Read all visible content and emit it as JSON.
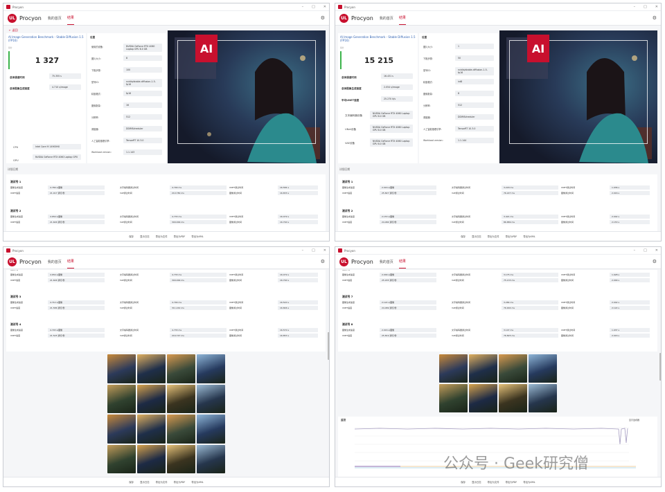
{
  "window_title": "Procyon",
  "brand": "Procyon",
  "tabs": [
    "我的首页",
    "结果"
  ],
  "back_label": "← 返回",
  "footer_buttons": [
    "保存",
    "显示日志",
    "导出为文件",
    "导出为PDF",
    "导出为XML"
  ],
  "w1": {
    "bench_title": "AI Image Generation Benchmark - Stable Diffusion 1.5 (FP16)",
    "stat": "得分",
    "score": "1 327",
    "total_time_label": "总体通道时间",
    "total_time": "75.355 s",
    "speed_label": "总体图像生成速度",
    "speed": "4.710 s/image",
    "cpu_label": "CPU",
    "cpu": "Intel Core i9 14900HX",
    "gpu_label": "GPU",
    "gpu": "NVIDIA GeForce RTX 4060 Laptop GPU",
    "settings_title": "设置",
    "settings": [
      {
        "k": "使用的设备:",
        "v": "NVIDIA GeForce RTX 4060 Laptop GPU 8.0 GB"
      },
      {
        "k": "图片大小:",
        "v": "8"
      },
      {
        "k": "下推步骤:",
        "v": "100"
      },
      {
        "k": "型号ID:",
        "v": "nvidia/stable-diffusion-1-5-fp16"
      },
      {
        "k": "精度格式:",
        "v": "fp16"
      },
      {
        "k": "图像数量:",
        "v": "16"
      },
      {
        "k": "分辨率:",
        "v": "512"
      },
      {
        "k": "调度器:",
        "v": "DDIMScheduler"
      },
      {
        "k": "人工智能推理引擎:",
        "v": "TensorRT 10.3.0"
      },
      {
        "k": "Workload version:",
        "v": "1.1.143"
      }
    ],
    "detail_label": "详细日期",
    "runs": [
      {
        "name": "测试号 1",
        "rows": [
          [
            "图像生成速度",
            "4.766 s/图像",
            "文字编码器通过时间",
            "4.790 ms",
            "UNET通过时间",
            "16.584 s"
          ],
          [
            "UNET速度",
            "21.017 通行/秒",
            "VAE通过时间",
            "210.780 ms",
            "图像通过时间",
            "16.833 s"
          ]
        ]
      },
      {
        "name": "测试号 2",
        "rows": [
          [
            "图像生成速度",
            "4.659 s/图像",
            "文字编码器通过时间",
            "4.733 ms",
            "UNET通过时间",
            "16.479 s"
          ],
          [
            "UNET速度",
            "21.646 通行/秒",
            "VAE通过时间",
            "309.999 ms",
            "图像通过时间",
            "16.790 s"
          ]
        ]
      }
    ]
  },
  "w2": {
    "bench_title": "AI Image Generation Benchmark - Stable Diffusion 1.5 (FP16)",
    "stat": "得分",
    "score": "15 215",
    "total_time_label": "总体通道时间",
    "total_time": "16.431 s",
    "speed_label": "总体图像生成速度",
    "speed": "2.054 s/image",
    "unet_label": "平均UNET速度",
    "unet": "25.270 it/s",
    "d1_label": "文本编码器设备",
    "d1": "NVIDIA GeForce RTX 4060 Laptop GPU 8.0 GB",
    "d2_label": "UNet设备",
    "d2": "NVIDIA GeForce RTX 4060 Laptop GPU 8.0 GB",
    "d3_label": "VAE设备",
    "d3": "NVIDIA GeForce RTX 4060 Laptop GPU 8.0 GB",
    "settings_title": "设置",
    "settings": [
      {
        "k": "图片大小:",
        "v": "1"
      },
      {
        "k": "下推步骤:",
        "v": "50"
      },
      {
        "k": "型号ID:",
        "v": "nvidia/stable-diffusion-1-5-fp16"
      },
      {
        "k": "精度格式:",
        "v": "int8"
      },
      {
        "k": "图像数量:",
        "v": "8"
      },
      {
        "k": "分辨率:",
        "v": "512"
      },
      {
        "k": "调度器:",
        "v": "DDIMScheduler"
      },
      {
        "k": "人工智能推理引擎:",
        "v": "TensorRT 10.3.0"
      },
      {
        "k": "Workload version:",
        "v": "1.1.144"
      }
    ],
    "detail_label": "详细日期",
    "runs": [
      {
        "name": "测试号 1",
        "rows": [
          [
            "图像生成速度",
            "2.016 s/图像",
            "文字编码器通过时间",
            "3.218 ms",
            "UNET通过时间",
            "1.936 s"
          ],
          [
            "UNET速度",
            "25.827 通行/秒",
            "VAE通过时间",
            "76.227 ms",
            "图像通过时间",
            "2.016 s"
          ]
        ]
      },
      {
        "name": "测试号 2",
        "rows": [
          [
            "图像生成速度",
            "2.153 s/图像",
            "文字编码器通过时间",
            "3.421 ms",
            "UNET通过时间",
            "2.042 s"
          ],
          [
            "UNET速度",
            "24.484 通行/秒",
            "VAE通过时间",
            "86.889 ms",
            "图像通过时间",
            "2.153 s"
          ]
        ]
      }
    ]
  },
  "w3": {
    "runs": [
      {
        "name": "测试号 2",
        "rows": [
          [
            "图像生成速度",
            "4.659 s/图像",
            "文字编码器通过时间",
            "4.733 ms",
            "UNET通过时间",
            "16.479 s"
          ],
          [
            "UNET速度",
            "21.646 通行/秒",
            "VAE通过时间",
            "309.999 ms",
            "图像通过时间",
            "16.790 s"
          ]
        ]
      },
      {
        "name": "测试号 3",
        "rows": [
          [
            "图像生成速度",
            "4.712 s/图像",
            "文字编码器通过时间",
            "4.790 ms",
            "UNET通过时间",
            "16.520 s"
          ],
          [
            "UNET速度",
            "21.586 通行/秒",
            "VAE通过时间",
            "311.242 ms",
            "图像通过时间",
            "16.846 s"
          ]
        ]
      },
      {
        "name": "测试号 4",
        "rows": [
          [
            "图像生成速度",
            "4.703 s/图像",
            "文字编码器通过时间",
            "4.733 ms",
            "UNET通过时间",
            "16.570 s"
          ],
          [
            "UNET速度",
            "21.525 通行/秒",
            "VAE通过时间",
            "216.747 ms",
            "图像通过时间",
            "16.853 s"
          ]
        ]
      }
    ]
  },
  "w4": {
    "runs": [
      {
        "name": "测试号 6",
        "rows": [
          [
            "图像生成速度",
            "2.009 s/图像",
            "文字编码器通过时间",
            "3.175 ms",
            "UNET通过时间",
            "1.928 s"
          ],
          [
            "UNET速度",
            "25.935 通行/秒",
            "VAE通过时间",
            "75.133 ms",
            "图像通过时间",
            "2.009 s"
          ]
        ]
      },
      {
        "name": "测试号 7",
        "rows": [
          [
            "图像生成速度",
            "2.122 s/图像",
            "文字编码器通过时间",
            "3.284 ms",
            "UNET通过时间",
            "2.042 s"
          ],
          [
            "UNET速度",
            "24.489 通行/秒",
            "VAE通过时间",
            "76.904 ms",
            "图像通过时间",
            "2.122 s"
          ]
        ]
      },
      {
        "name": "测试号 8",
        "rows": [
          [
            "图像生成速度",
            "2.016 s/图像",
            "文字编码器通过时间",
            "3.147 ms",
            "UNET通过时间",
            "1.937 s"
          ],
          [
            "UNET速度",
            "25.819 通行/秒",
            "VAE通过时间",
            "76.825 ms",
            "图像通过时间",
            "2.016 s"
          ]
        ]
      }
    ],
    "monitor_title": "监控",
    "monitor_toggle": "显示监视器"
  },
  "watermark": "公众号 · Geek研究僧",
  "colors": {
    "brand": "#c8102e",
    "accent_green": "#3bb34a",
    "link": "#2a5db0"
  }
}
